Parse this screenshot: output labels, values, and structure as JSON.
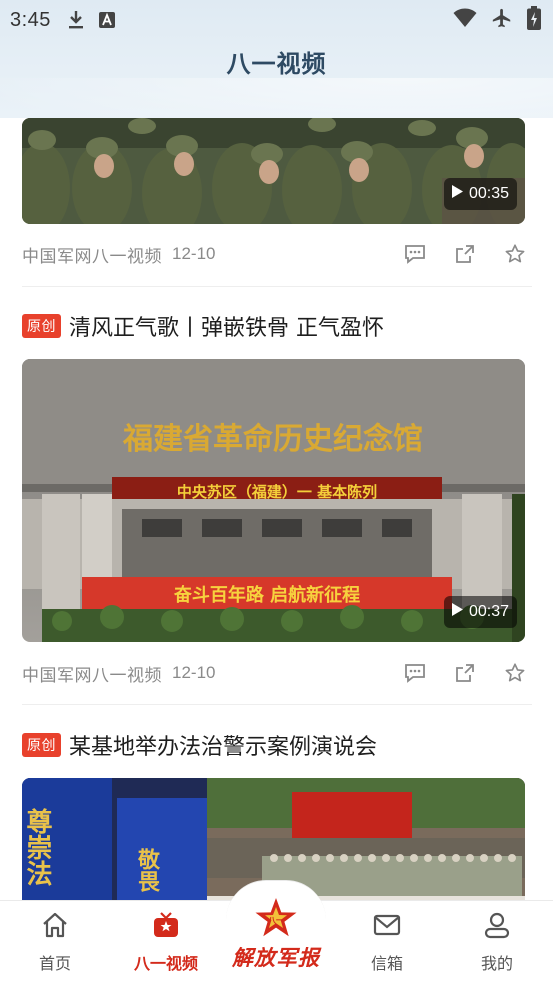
{
  "status_bar": {
    "time": "3:45",
    "left_icons": [
      "download-icon",
      "a-box-icon"
    ],
    "right_icons": [
      "wifi-icon",
      "airplane-icon",
      "battery-charging-icon"
    ]
  },
  "header": {
    "title": "八一视频"
  },
  "feed": [
    {
      "has_headline": false,
      "duration": "00:35",
      "source": "中国军网八一视频",
      "date": "12-10"
    },
    {
      "has_headline": true,
      "badge": "原创",
      "headline": "清风正气歌丨弹嵌铁骨 正气盈怀",
      "thumb_sign_main": "福建省革命历史纪念馆",
      "thumb_sign_red": "中央苏区（福建）一 基本陈列",
      "thumb_banner": "奋斗百年路 启航新征程",
      "duration": "00:37",
      "source": "中国军网八一视频",
      "date": "12-10"
    },
    {
      "has_headline": true,
      "badge": "原创",
      "headline": "某基地举办法治警示案例演说会",
      "thumb_left_text_1": "尊崇法",
      "thumb_left_text_2": "敬畏"
    }
  ],
  "bottom_nav": {
    "items": [
      {
        "label": "首页",
        "icon": "home-icon",
        "active": false
      },
      {
        "label": "八一视频",
        "icon": "tv-icon",
        "active": true
      },
      {
        "label": "解放军报",
        "icon": "army-star-logo",
        "active": false
      },
      {
        "label": "信箱",
        "icon": "mail-icon",
        "active": false
      },
      {
        "label": "我的",
        "icon": "user-icon",
        "active": false
      }
    ]
  },
  "colors": {
    "accent": "#d32a1b",
    "badge": "#e8412c",
    "header_bg": "#e3edf5",
    "meta_text": "#8a8a8a"
  }
}
